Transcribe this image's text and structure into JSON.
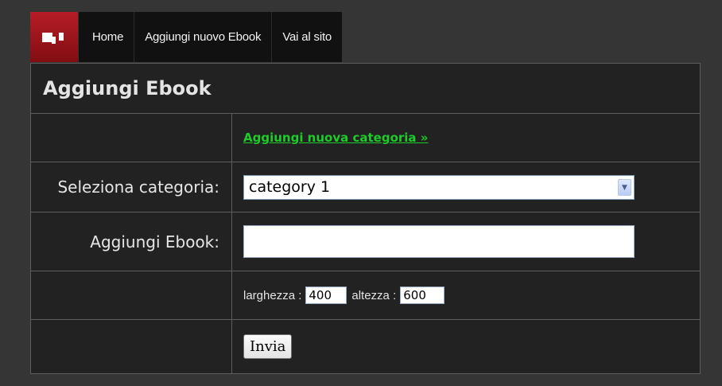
{
  "nav": {
    "logo_icon": "app-logo-icon",
    "items": [
      {
        "label": "Home"
      },
      {
        "label": "Aggiungi nuovo Ebook"
      },
      {
        "label": "Vai al sito"
      }
    ]
  },
  "panel": {
    "title": "Aggiungi Ebook",
    "add_category_link": "Aggiungi nuova categoria »",
    "category_label": "Seleziona categoria:",
    "category_value": "category 1",
    "ebook_label": "Aggiungi Ebook:",
    "ebook_value": "",
    "width_label": "larghezza :",
    "width_value": "400",
    "height_label": "altezza :",
    "height_value": "600",
    "submit_label": "Invia"
  },
  "colors": {
    "accent": "#b61d26",
    "link": "#1ecb2a",
    "background": "#353535",
    "panel": "#222222"
  }
}
